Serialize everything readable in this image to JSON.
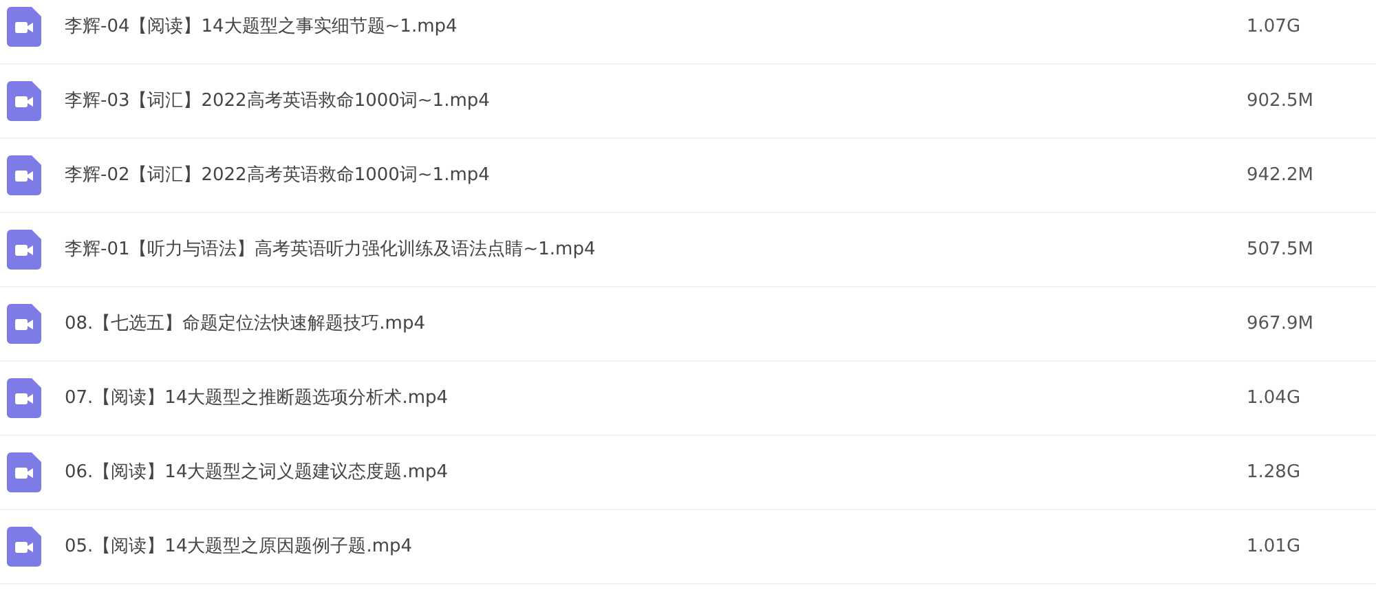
{
  "files": [
    {
      "name": "李辉-04【阅读】14大题型之事实细节题~1.mp4",
      "size": "1.07G"
    },
    {
      "name": "李辉-03【词汇】2022高考英语救命1000词~1.mp4",
      "size": "902.5M"
    },
    {
      "name": "李辉-02【词汇】2022高考英语救命1000词~1.mp4",
      "size": "942.2M"
    },
    {
      "name": "李辉-01【听力与语法】高考英语听力强化训练及语法点睛~1.mp4",
      "size": "507.5M"
    },
    {
      "name": "08.【七选五】命题定位法快速解题技巧.mp4",
      "size": "967.9M"
    },
    {
      "name": "07.【阅读】14大题型之推断题选项分析术.mp4",
      "size": "1.04G"
    },
    {
      "name": "06.【阅读】14大题型之词义题建议态度题.mp4",
      "size": "1.28G"
    },
    {
      "name": "05.【阅读】14大题型之原因题例子题.mp4",
      "size": "1.01G"
    }
  ]
}
